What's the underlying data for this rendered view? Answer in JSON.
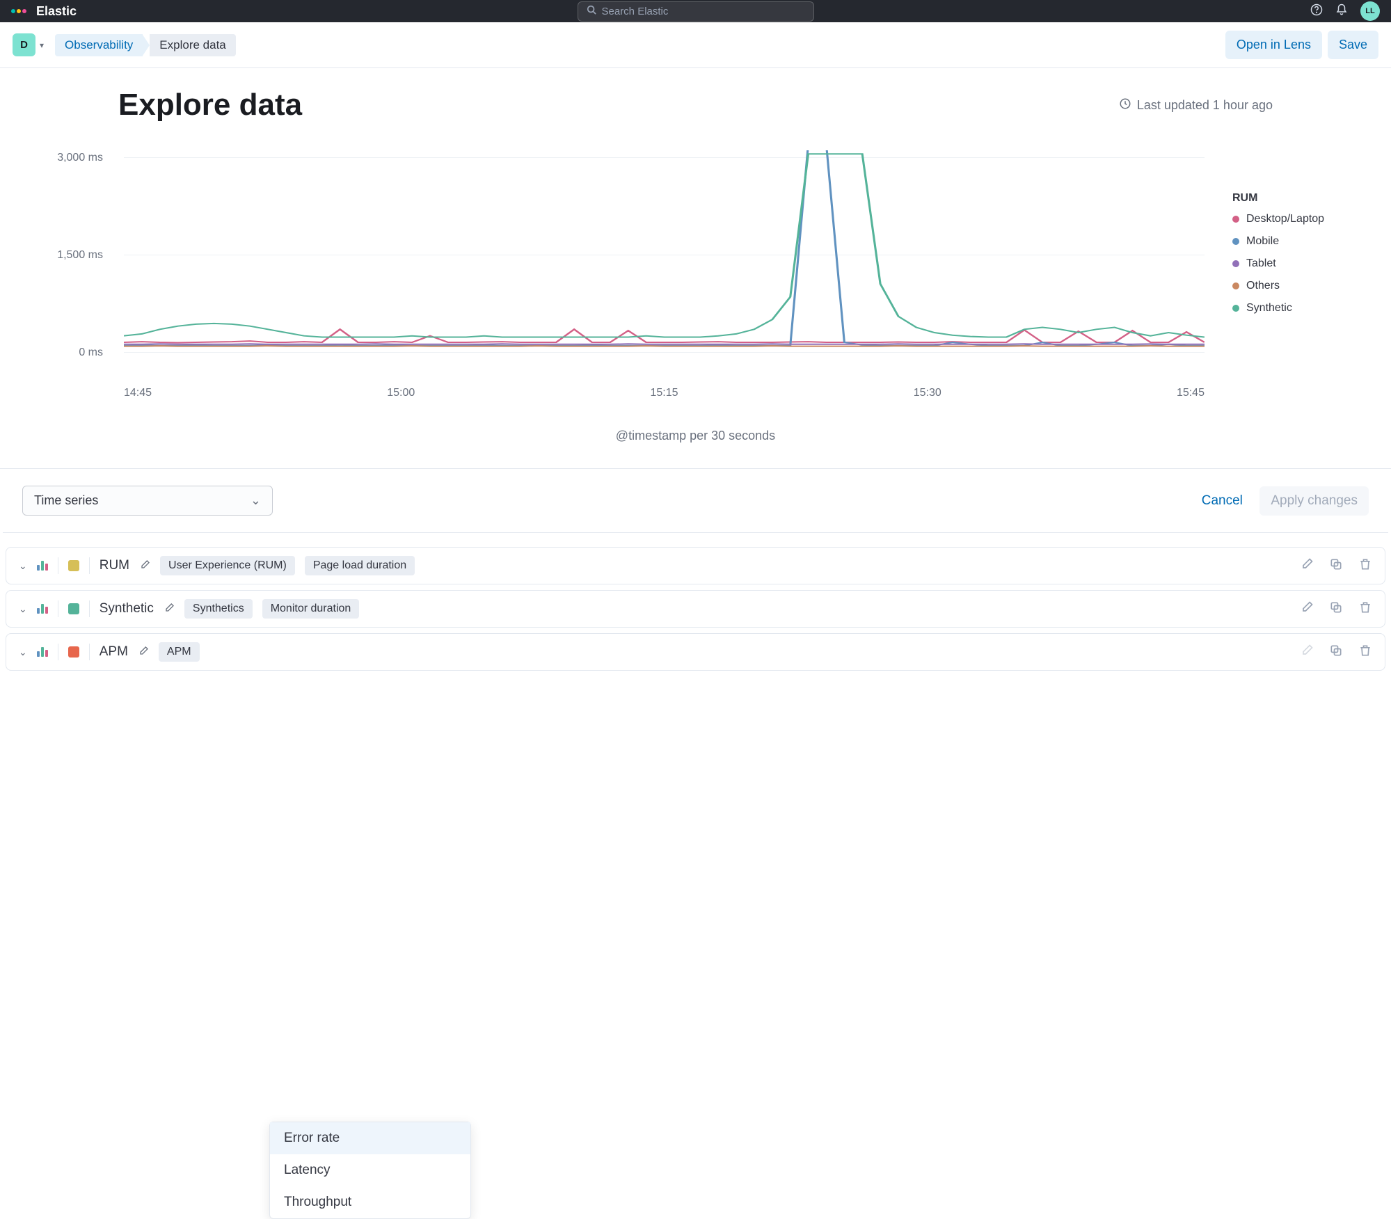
{
  "brand": "Elastic",
  "search_placeholder": "Search Elastic",
  "avatar_initials": "LL",
  "space_letter": "D",
  "breadcrumb": {
    "first": "Observability",
    "last": "Explore data"
  },
  "action_open_lens": "Open in Lens",
  "action_save": "Save",
  "page_title": "Explore data",
  "last_updated": "Last updated 1 hour ago",
  "x_axis_title": "@timestamp per 30 seconds",
  "legend_title": "RUM",
  "legend": [
    {
      "label": "Desktop/Laptop",
      "color": "#d36086"
    },
    {
      "label": "Mobile",
      "color": "#6092c0"
    },
    {
      "label": "Tablet",
      "color": "#9170b8"
    },
    {
      "label": "Others",
      "color": "#ca8861"
    },
    {
      "label": "Synthetic",
      "color": "#54b399"
    }
  ],
  "viz_type": "Time series",
  "cancel": "Cancel",
  "apply": "Apply changes",
  "series_rows": [
    {
      "name": "RUM",
      "color": "#d6bf57",
      "tags": [
        "User Experience (RUM)",
        "Page load duration"
      ]
    },
    {
      "name": "Synthetic",
      "color": "#54b399",
      "tags": [
        "Synthetics",
        "Monitor duration"
      ]
    },
    {
      "name": "APM",
      "color": "#e7664c",
      "tags": [
        "APM"
      ]
    }
  ],
  "dropdown": [
    "Error rate",
    "Latency",
    "Throughput"
  ],
  "chart_data": {
    "type": "line",
    "xlabel": "@timestamp per 30 seconds",
    "ylabel": "",
    "ylim": [
      0,
      3000
    ],
    "y_ticks": [
      "0 ms",
      "1,500 ms",
      "3,000 ms"
    ],
    "x_ticks": [
      "14:45",
      "15:00",
      "15:15",
      "15:30",
      "15:45"
    ],
    "x": [
      "14:45",
      "14:46",
      "14:47",
      "14:48",
      "14:49",
      "14:50",
      "14:51",
      "14:52",
      "14:53",
      "14:54",
      "14:55",
      "14:56",
      "14:57",
      "14:58",
      "14:59",
      "15:00",
      "15:01",
      "15:02",
      "15:03",
      "15:04",
      "15:05",
      "15:06",
      "15:07",
      "15:08",
      "15:09",
      "15:10",
      "15:11",
      "15:12",
      "15:13",
      "15:14",
      "15:15",
      "15:16",
      "15:17",
      "15:18",
      "15:19",
      "15:20",
      "15:21",
      "15:22",
      "15:23",
      "15:24",
      "15:25",
      "15:26",
      "15:27",
      "15:28",
      "15:29",
      "15:30",
      "15:31",
      "15:32",
      "15:33",
      "15:34",
      "15:35",
      "15:36",
      "15:37",
      "15:38",
      "15:39",
      "15:40",
      "15:41",
      "15:42",
      "15:43",
      "15:44",
      "15:45"
    ],
    "series": [
      {
        "name": "Desktop/Laptop",
        "color": "#d36086",
        "values": [
          150,
          160,
          150,
          145,
          150,
          155,
          160,
          170,
          150,
          150,
          160,
          150,
          350,
          150,
          150,
          160,
          150,
          250,
          150,
          150,
          155,
          160,
          150,
          150,
          150,
          350,
          150,
          150,
          330,
          150,
          150,
          150,
          155,
          160,
          150,
          150,
          150,
          155,
          160,
          150,
          150,
          150,
          150,
          155,
          150,
          150,
          160,
          150,
          150,
          150,
          340,
          150,
          150,
          320,
          150,
          150,
          330,
          150,
          150,
          310,
          150
        ]
      },
      {
        "name": "Mobile",
        "color": "#6092c0",
        "values": [
          100,
          105,
          100,
          100,
          105,
          100,
          100,
          100,
          105,
          100,
          100,
          100,
          110,
          100,
          100,
          105,
          100,
          100,
          100,
          100,
          105,
          100,
          100,
          100,
          100,
          100,
          105,
          100,
          100,
          100,
          100,
          100,
          100,
          105,
          100,
          100,
          100,
          100,
          3200,
          3200,
          150,
          110,
          100,
          100,
          100,
          100,
          150,
          120,
          100,
          100,
          100,
          150,
          100,
          100,
          120,
          150,
          100,
          100,
          120,
          100,
          100
        ]
      },
      {
        "name": "Tablet",
        "color": "#9170b8",
        "values": [
          120,
          120,
          125,
          120,
          120,
          120,
          120,
          125,
          120,
          120,
          120,
          120,
          120,
          120,
          125,
          120,
          120,
          120,
          120,
          120,
          120,
          125,
          120,
          120,
          120,
          120,
          120,
          120,
          125,
          120,
          120,
          120,
          120,
          120,
          120,
          120,
          125,
          120,
          120,
          120,
          120,
          120,
          120,
          125,
          120,
          120,
          120,
          120,
          120,
          120,
          125,
          120,
          120,
          120,
          120,
          120,
          120,
          125,
          120,
          120,
          120
        ]
      },
      {
        "name": "Others",
        "color": "#ca8861",
        "values": [
          90,
          90,
          95,
          90,
          90,
          90,
          90,
          90,
          95,
          90,
          90,
          90,
          90,
          90,
          90,
          90,
          95,
          90,
          90,
          90,
          90,
          90,
          90,
          95,
          90,
          90,
          90,
          90,
          90,
          95,
          90,
          90,
          90,
          90,
          90,
          90,
          95,
          90,
          90,
          90,
          90,
          90,
          90,
          95,
          90,
          90,
          90,
          90,
          90,
          90,
          95,
          90,
          90,
          90,
          90,
          90,
          90,
          95,
          90,
          90,
          90
        ]
      },
      {
        "name": "Synthetic",
        "color": "#54b399",
        "values": [
          250,
          280,
          350,
          400,
          430,
          440,
          430,
          400,
          350,
          300,
          250,
          230,
          230,
          230,
          230,
          230,
          250,
          230,
          230,
          230,
          250,
          230,
          230,
          230,
          230,
          230,
          230,
          230,
          230,
          250,
          230,
          230,
          230,
          250,
          280,
          350,
          500,
          850,
          3050,
          3050,
          3050,
          3050,
          1050,
          550,
          380,
          300,
          260,
          240,
          230,
          230,
          350,
          380,
          350,
          300,
          350,
          380,
          300,
          250,
          300,
          260,
          230
        ]
      }
    ]
  }
}
